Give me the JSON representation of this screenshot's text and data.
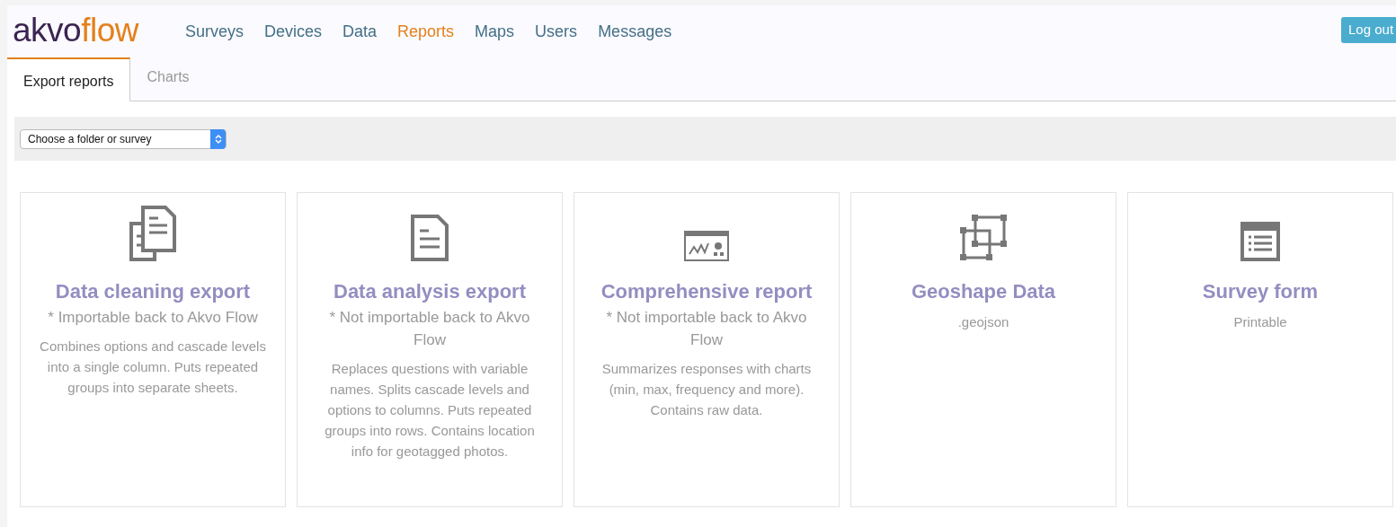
{
  "logo": {
    "part1": "akvo",
    "part2": "flow"
  },
  "nav": [
    {
      "label": "Surveys",
      "selected": false
    },
    {
      "label": "Devices",
      "selected": false
    },
    {
      "label": "Data",
      "selected": false
    },
    {
      "label": "Reports",
      "selected": true
    },
    {
      "label": "Maps",
      "selected": false
    },
    {
      "label": "Users",
      "selected": false
    },
    {
      "label": "Messages",
      "selected": false
    }
  ],
  "logout": "Log out",
  "tabs": [
    {
      "label": "Export reports",
      "selected": true
    },
    {
      "label": "Charts",
      "selected": false
    }
  ],
  "survey_select": {
    "value": "Choose a folder or survey"
  },
  "cards": [
    {
      "kind": "copies",
      "title": "Data cleaning export",
      "note": "* Importable back to Akvo Flow",
      "description": "Combines options and cascade levels into a single column. Puts repeated groups into separate sheets."
    },
    {
      "kind": "document",
      "title": "Data analysis export",
      "note": "* Not importable back to Akvo Flow",
      "description": "Replaces questions with variable names. Splits cascade levels and options to columns. Puts repeated groups into rows. Contains location info for geotagged photos."
    },
    {
      "kind": "chart",
      "title": "Comprehensive report",
      "note": "* Not importable back to Akvo Flow",
      "description": "Summarizes responses with charts (min, max, frequency and more). Contains raw data."
    },
    {
      "kind": "shape",
      "title": "Geoshape Data",
      "description": ".geojson"
    },
    {
      "kind": "form",
      "title": "Survey form",
      "description": "Printable"
    }
  ]
}
